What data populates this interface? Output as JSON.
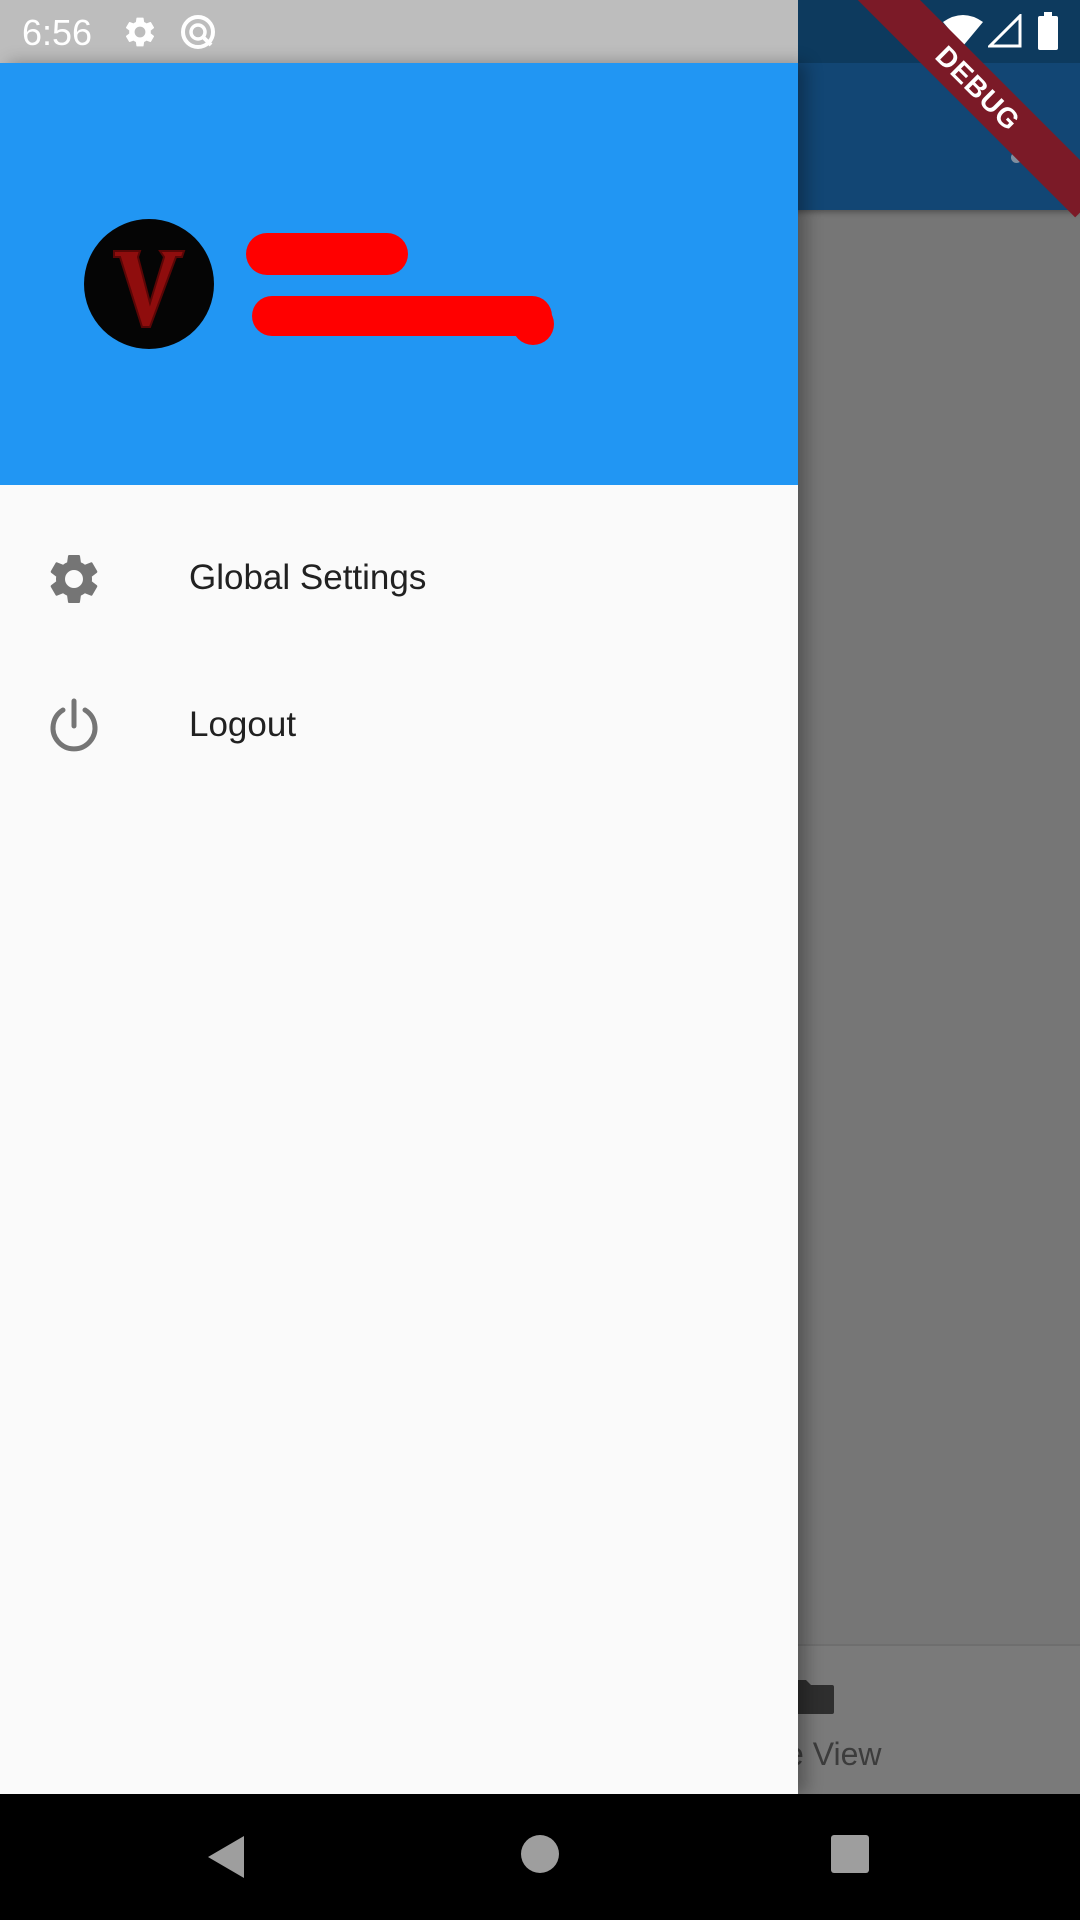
{
  "status_bar": {
    "time": "6:56",
    "icons": [
      "settings-icon",
      "sync-icon",
      "wifi-icon",
      "signal-icon",
      "battery-icon"
    ]
  },
  "debug_banner": "DEBUG",
  "app_bar": {
    "menu_icon": "more-vert-icon"
  },
  "drawer": {
    "header": {
      "avatar_letter": "V",
      "name_redacted": "",
      "email_redacted": ""
    },
    "items": [
      {
        "label": "Global Settings",
        "icon": "gear-icon"
      },
      {
        "label": "Logout",
        "icon": "power-icon"
      }
    ]
  },
  "bottom_nav": {
    "partial_label": "se View",
    "icon": "folder-icon"
  },
  "nav_bar": {
    "buttons": [
      "back-icon",
      "home-icon",
      "recents-icon"
    ]
  },
  "colors": {
    "header_blue": "#2196f3",
    "app_bar_dim": "#124674",
    "scrim": "#767676",
    "debug_red": "#7b1a27",
    "redaction": "#ff0000"
  }
}
